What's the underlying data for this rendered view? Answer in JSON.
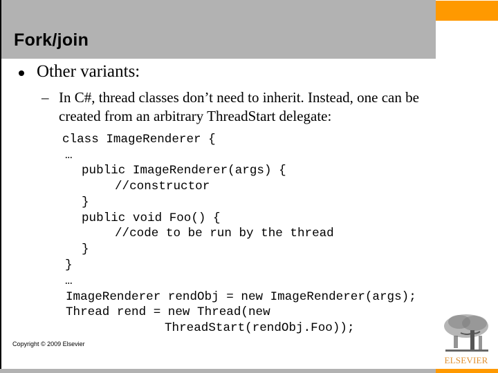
{
  "slide": {
    "title": "Fork/join",
    "bullet": "Other variants:",
    "sub_bullet_lines": [
      "In C#, thread classes don’t need to inherit.  Instead, one can be",
      "created from an arbitrary ThreadStart delegate:"
    ],
    "code_lines": [
      "class ImageRenderer {",
      "…",
      "public ImageRenderer(args) {",
      "//constructor",
      "}",
      "public void Foo() {",
      "//code to be run by the thread",
      "}",
      "}",
      "…",
      "ImageRenderer rendObj = new ImageRenderer(args);",
      "Thread rend = new Thread(new",
      "ThreadStart(rendObj.Foo));"
    ],
    "copyright": "Copyright © 2009 Elsevier",
    "logo": {
      "name": "elsevier-tree-logo",
      "text": "ELSEVIER"
    }
  },
  "colors": {
    "title_band": "#b2b2b2",
    "accent": "#ff9900",
    "logo_text": "#e09030"
  }
}
